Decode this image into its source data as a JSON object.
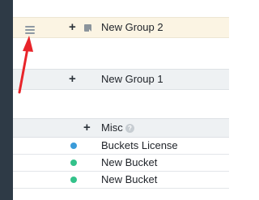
{
  "groups": [
    {
      "name": "New Group 2",
      "add_glyph": "+",
      "icons": [
        "drag-handle-icon",
        "note-icon"
      ]
    },
    {
      "name": "New Group 1",
      "add_glyph": "+"
    },
    {
      "name": "Misc",
      "add_glyph": "+",
      "help_glyph": "?"
    }
  ],
  "buckets": [
    {
      "name": "Buckets License",
      "color": "#3a9bd9"
    },
    {
      "name": "New Bucket",
      "color": "#33c28a"
    },
    {
      "name": "New Bucket",
      "color": "#33c28a"
    }
  ],
  "colors": {
    "sidebar": "#2e3a46",
    "highlight_row": "#fbf4e3",
    "group_row": "#eef1f3",
    "annotation_arrow": "#e8242a"
  }
}
